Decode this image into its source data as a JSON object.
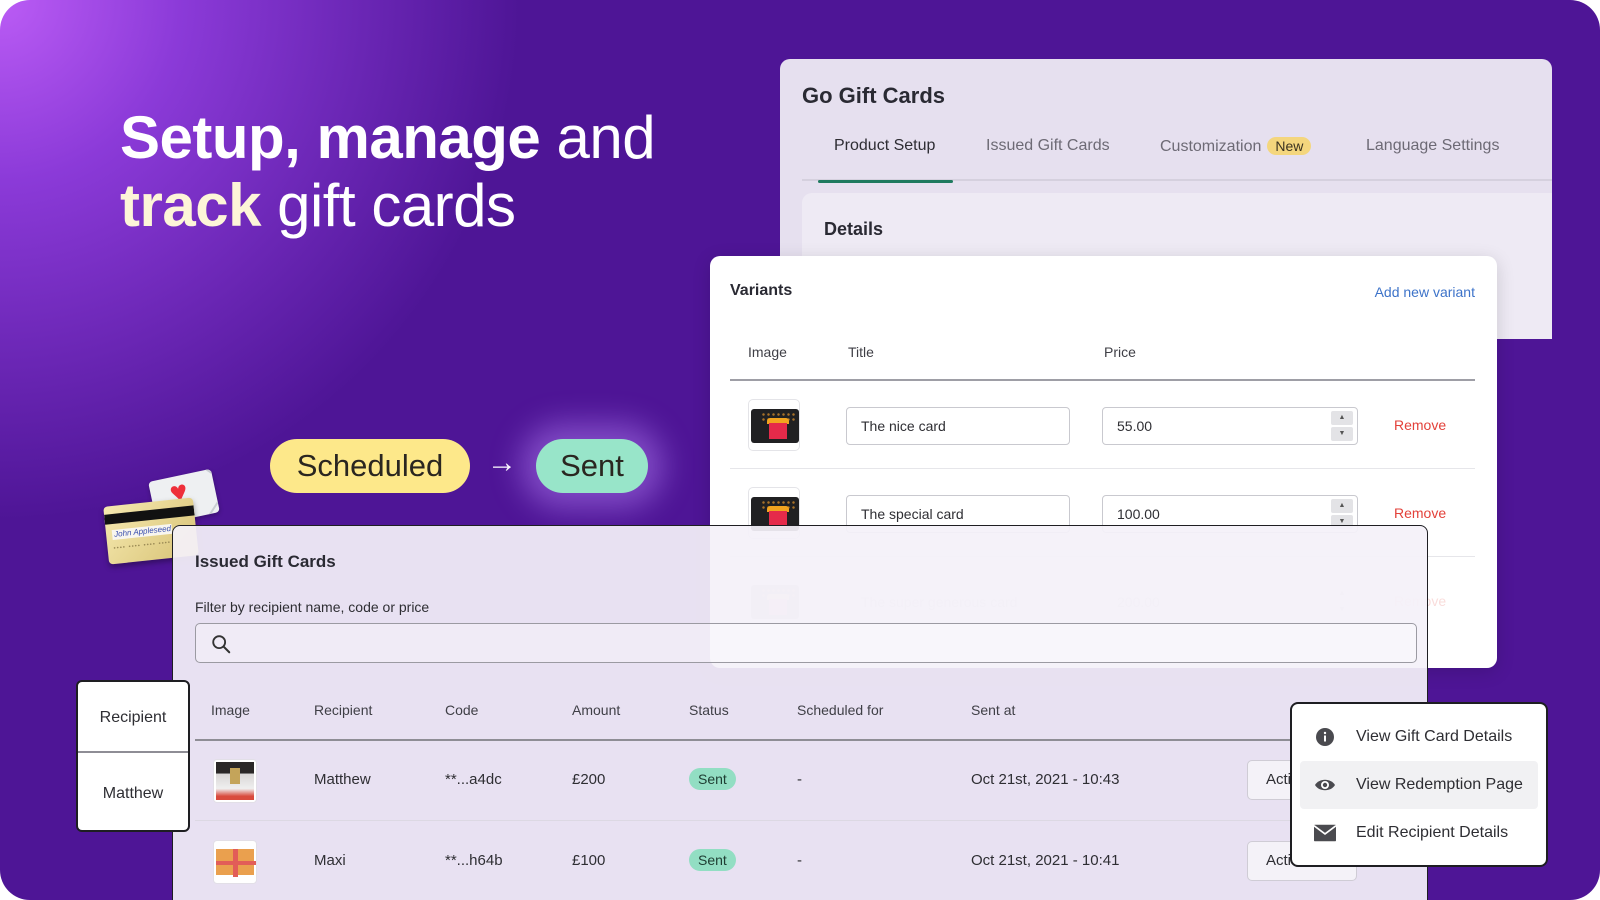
{
  "headline": {
    "line1_bold": "Setup, manage",
    "line1_light": " and",
    "line2_bold": "track",
    "line2_light": " gift cards"
  },
  "status_flow": {
    "from": "Scheduled",
    "arrow": "→",
    "to": "Sent"
  },
  "decoration": {
    "card_signature": "John Appleseed"
  },
  "app": {
    "title": "Go Gift Cards",
    "tabs": [
      {
        "label": "Product Setup",
        "active": true
      },
      {
        "label": "Issued Gift Cards",
        "active": false
      },
      {
        "label": "Customization",
        "badge": "New",
        "active": false
      },
      {
        "label": "Language Settings",
        "active": false
      }
    ],
    "details_title": "Details"
  },
  "variants": {
    "title": "Variants",
    "add_link": "Add new variant",
    "columns": [
      "Image",
      "Title",
      "Price"
    ],
    "rows": [
      {
        "title": "The nice card",
        "price": "55.00",
        "remove": "Remove"
      },
      {
        "title": "The special card",
        "price": "100.00",
        "remove": "Remove"
      },
      {
        "title": "The super generous card",
        "price": "200.00",
        "remove": "Remove"
      }
    ]
  },
  "issued": {
    "title": "Issued Gift Cards",
    "filter_label": "Filter by recipient name, code or price",
    "search_placeholder": "",
    "columns": [
      "Image",
      "Recipient",
      "Code",
      "Amount",
      "Status",
      "Scheduled for",
      "Sent at"
    ],
    "rows": [
      {
        "recipient": "Matthew",
        "code": "**...a4dc",
        "amount": "£200",
        "status": "Sent",
        "scheduled_for": "-",
        "sent_at": "Oct 21st, 2021 - 10:43",
        "action": "Actions"
      },
      {
        "recipient": "Maxi",
        "code": "**...h64b",
        "amount": "£100",
        "status": "Sent",
        "scheduled_for": "-",
        "sent_at": "Oct 21st, 2021 - 10:41",
        "action": "Actions"
      }
    ]
  },
  "action_menu": {
    "items": [
      {
        "label": "View Gift Card Details",
        "icon": "info-icon"
      },
      {
        "label": "View Redemption Page",
        "icon": "eye-icon",
        "hovered": true
      },
      {
        "label": "Edit Recipient Details",
        "icon": "mail-icon"
      }
    ]
  },
  "callout": {
    "header": "Recipient",
    "value": "Matthew"
  },
  "colors": {
    "background": "#4e1596",
    "accent_tab": "#1f7a5f",
    "scheduled_pill": "#fde88a",
    "sent_pill": "#98e5c9",
    "new_badge": "#f4d67d",
    "remove_link": "#e3413a",
    "add_link": "#3d73c9"
  }
}
